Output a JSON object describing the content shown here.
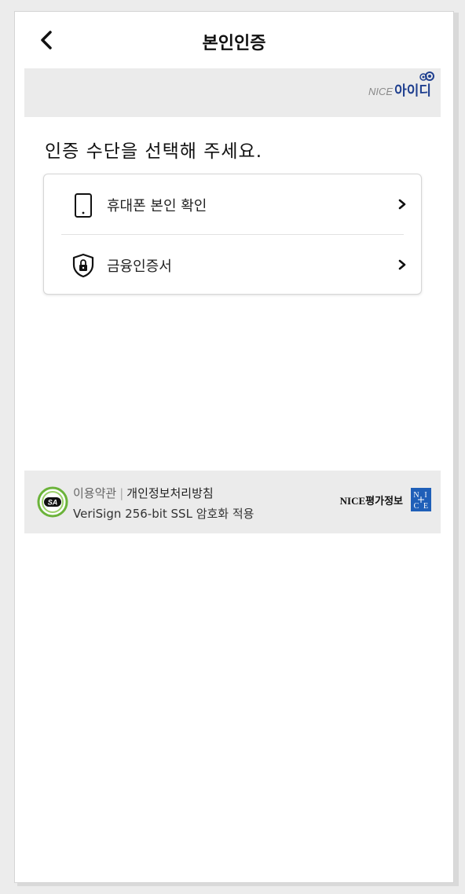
{
  "header": {
    "title": "본인인증",
    "back_icon": "chevron-left-icon"
  },
  "brand": {
    "prefix": "NICE",
    "name": "아이디",
    "accent_color": "#1f3f8f"
  },
  "prompt": "인증 수단을 선택해 주세요.",
  "options": [
    {
      "label": "휴대폰 본인 확인",
      "icon": "phone-icon"
    },
    {
      "label": "금융인증서",
      "icon": "shield-lock-icon"
    }
  ],
  "footer": {
    "badge": "SA",
    "terms_label": "이용약관",
    "separator": "|",
    "privacy_label": "개인정보처리방침",
    "ssl_text": "VeriSign 256-bit SSL 암호화 적용",
    "partner": "NICE평가정보",
    "partner_logo": [
      "N",
      "I",
      "C",
      "E"
    ]
  }
}
